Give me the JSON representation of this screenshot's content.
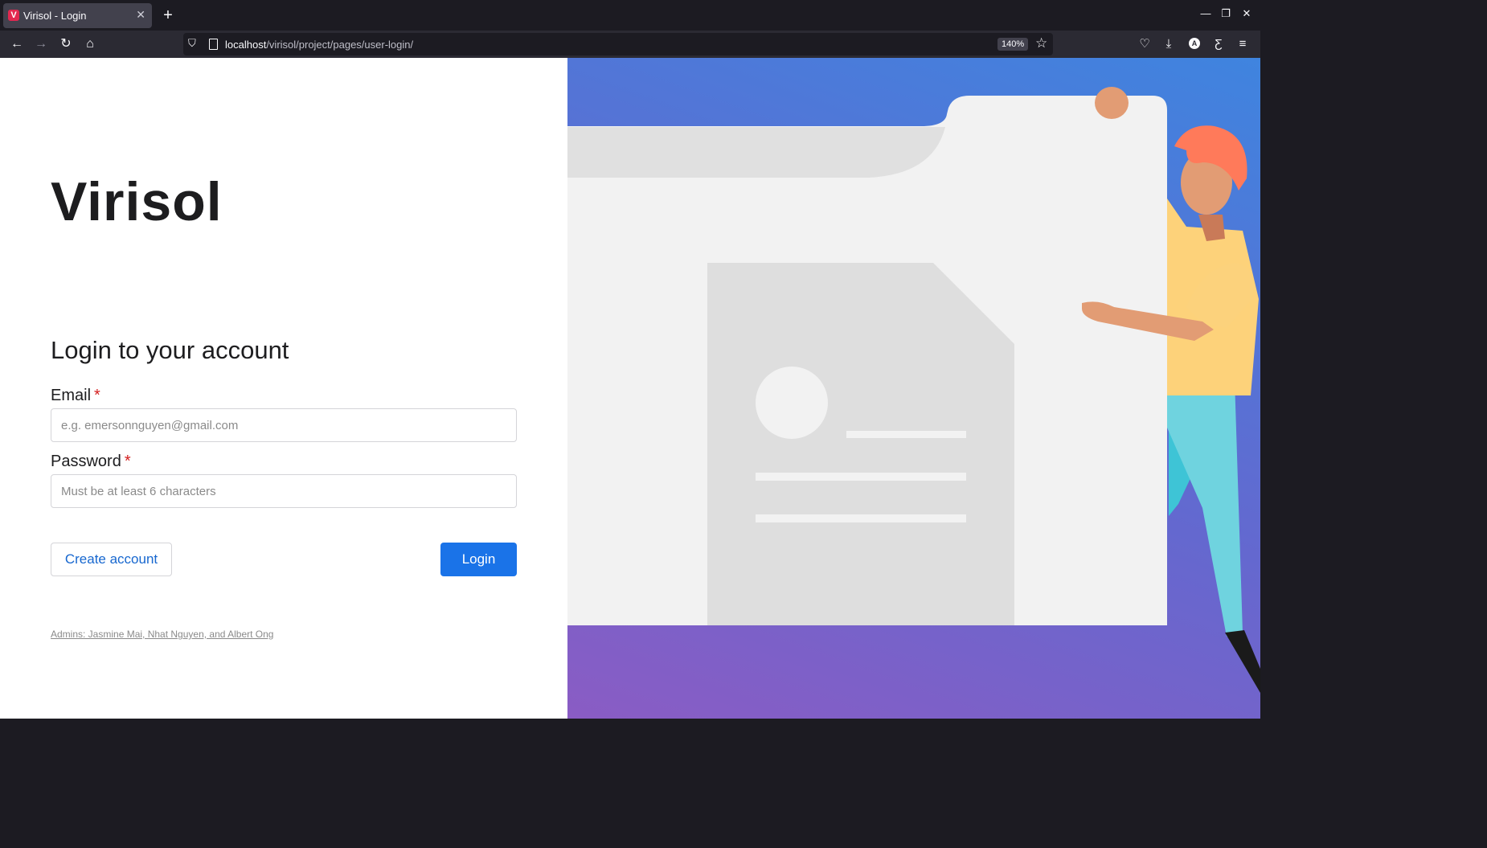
{
  "browser": {
    "tab_title": "Virisol - Login",
    "favicon_letter": "V",
    "url_host": "localhost",
    "url_path": "/virisol/project/pages/user-login/",
    "zoom": "140%"
  },
  "page": {
    "brand": "Virisol",
    "heading": "Login to your account",
    "email": {
      "label": "Email",
      "required": "*",
      "placeholder": "e.g. emersonnguyen@gmail.com",
      "value": ""
    },
    "password": {
      "label": "Password",
      "required": "*",
      "placeholder": "Must be at least 6 characters",
      "value": ""
    },
    "create_account_label": "Create account",
    "login_label": "Login",
    "admins_text": "Admins: Jasmine Mai, Nhat Nguyen, and Albert Ong"
  },
  "colors": {
    "accent": "#1a73e8",
    "link": "#1767cf",
    "required": "#d42020",
    "hero_gradient_start": "#8a5cc4",
    "hero_gradient_end": "#3f84df"
  },
  "icons": {
    "back": "back-arrow-icon",
    "forward": "forward-arrow-icon",
    "reload": "reload-icon",
    "home": "home-icon",
    "bookmark": "star-icon",
    "pocket": "pocket-icon",
    "download": "download-icon",
    "account": "account-icon",
    "extension": "extension-icon",
    "menu": "hamburger-menu-icon"
  }
}
